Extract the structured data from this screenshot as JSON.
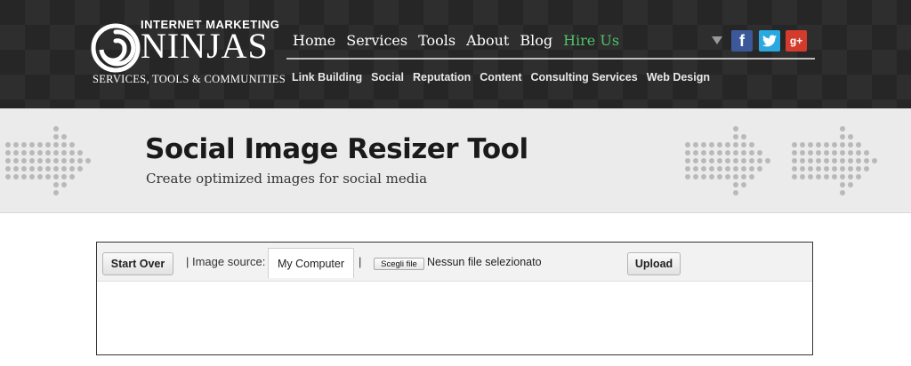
{
  "header": {
    "logo": {
      "top_text": "INTERNET MARKETING",
      "main_text": "NINJAS",
      "sub_text": "SERVICES, TOOLS & COMMUNITIES"
    },
    "main_nav": [
      {
        "label": "Home"
      },
      {
        "label": "Services"
      },
      {
        "label": "Tools"
      },
      {
        "label": "About"
      },
      {
        "label": "Blog"
      },
      {
        "label": "Hire Us",
        "color": "#4fc26a"
      }
    ],
    "sub_nav": [
      {
        "label": "Link Building"
      },
      {
        "label": "Social"
      },
      {
        "label": "Reputation"
      },
      {
        "label": "Content"
      },
      {
        "label": "Consulting Services"
      },
      {
        "label": "Web Design"
      }
    ],
    "social": {
      "facebook": {
        "glyph": "f",
        "icon": "facebook-icon",
        "color": "#3b5998"
      },
      "twitter": {
        "glyph": "🐦",
        "icon": "twitter-icon",
        "color": "#2aa9e0"
      },
      "googleplus": {
        "glyph": "g+",
        "icon": "google-plus-icon",
        "color": "#d33b2c"
      }
    }
  },
  "banner": {
    "title": "Social Image Resizer Tool",
    "subtitle": "Create optimized images for social media"
  },
  "tool": {
    "start_over_label": "Start Over",
    "separator": "|",
    "image_source_label": "| Image source:",
    "image_source_value": "My Computer",
    "file_button_label": "Scegli file",
    "file_status": "Nessun file selezionato",
    "upload_label": "Upload"
  },
  "colors": {
    "header_bg": "#262626",
    "accent_green": "#4fc26a",
    "banner_bg": "#ebebeb"
  }
}
